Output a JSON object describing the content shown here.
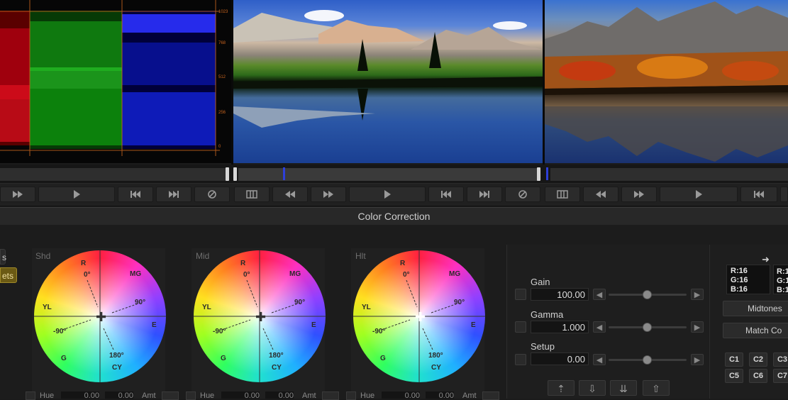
{
  "scope": {
    "scale_labels": [
      "1023",
      "768",
      "512",
      "256",
      "0"
    ]
  },
  "panel": {
    "title": "Color Correction"
  },
  "left_stubs": [
    "s",
    "ets"
  ],
  "wheels": [
    {
      "label": "Shd",
      "marks": {
        "r": "R",
        "mg": "MG",
        "yl": "YL",
        "e": "E",
        "g": "G",
        "cy": "CY",
        "deg0": "0°",
        "deg90": "90°",
        "degm90": "-90°",
        "deg180": "180°"
      }
    },
    {
      "label": "Mid",
      "marks": {
        "r": "R",
        "mg": "MG",
        "yl": "YL",
        "e": "E",
        "g": "G",
        "cy": "CY",
        "deg0": "0°",
        "deg90": "90°",
        "degm90": "-90°",
        "deg180": "180°"
      }
    },
    {
      "label": "Hlt",
      "marks": {
        "r": "R",
        "mg": "MG",
        "yl": "YL",
        "e": "E",
        "g": "G",
        "cy": "CY",
        "deg0": "0°",
        "deg90": "90°",
        "degm90": "-90°",
        "deg180": "180°"
      }
    }
  ],
  "wheel_bottom": {
    "hue": "Hue",
    "v1": "0.00",
    "v2": "0.00",
    "amt": "Amt"
  },
  "params": [
    {
      "label": "Gain",
      "value": "100.00"
    },
    {
      "label": "Gamma",
      "value": "1.000"
    },
    {
      "label": "Setup",
      "value": "0.00"
    }
  ],
  "picker": {
    "swatch1": [
      "R:16",
      "G:16",
      "B:16"
    ],
    "swatch2": [
      "R:1",
      "G:1",
      "B:1"
    ],
    "midtones": "Midtones",
    "match": "Match Co"
  },
  "memories": [
    "C1",
    "C2",
    "C3",
    "C5",
    "C6",
    "C7"
  ]
}
